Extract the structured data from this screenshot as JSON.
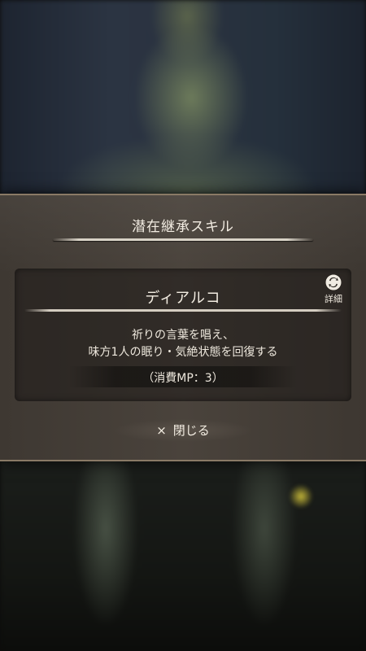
{
  "dialog": {
    "title": "潜在継承スキル",
    "skill": {
      "name": "ディアルコ",
      "description_line1": "祈りの言葉を唱え、",
      "description_line2": "味方1人の眠り・気絶状態を回復する",
      "mp_cost": "（消費MP：3）"
    },
    "detail_button": {
      "label": "詳細",
      "icon": "swap-icon"
    },
    "close_button": {
      "icon": "×",
      "label": "閉じる"
    }
  }
}
